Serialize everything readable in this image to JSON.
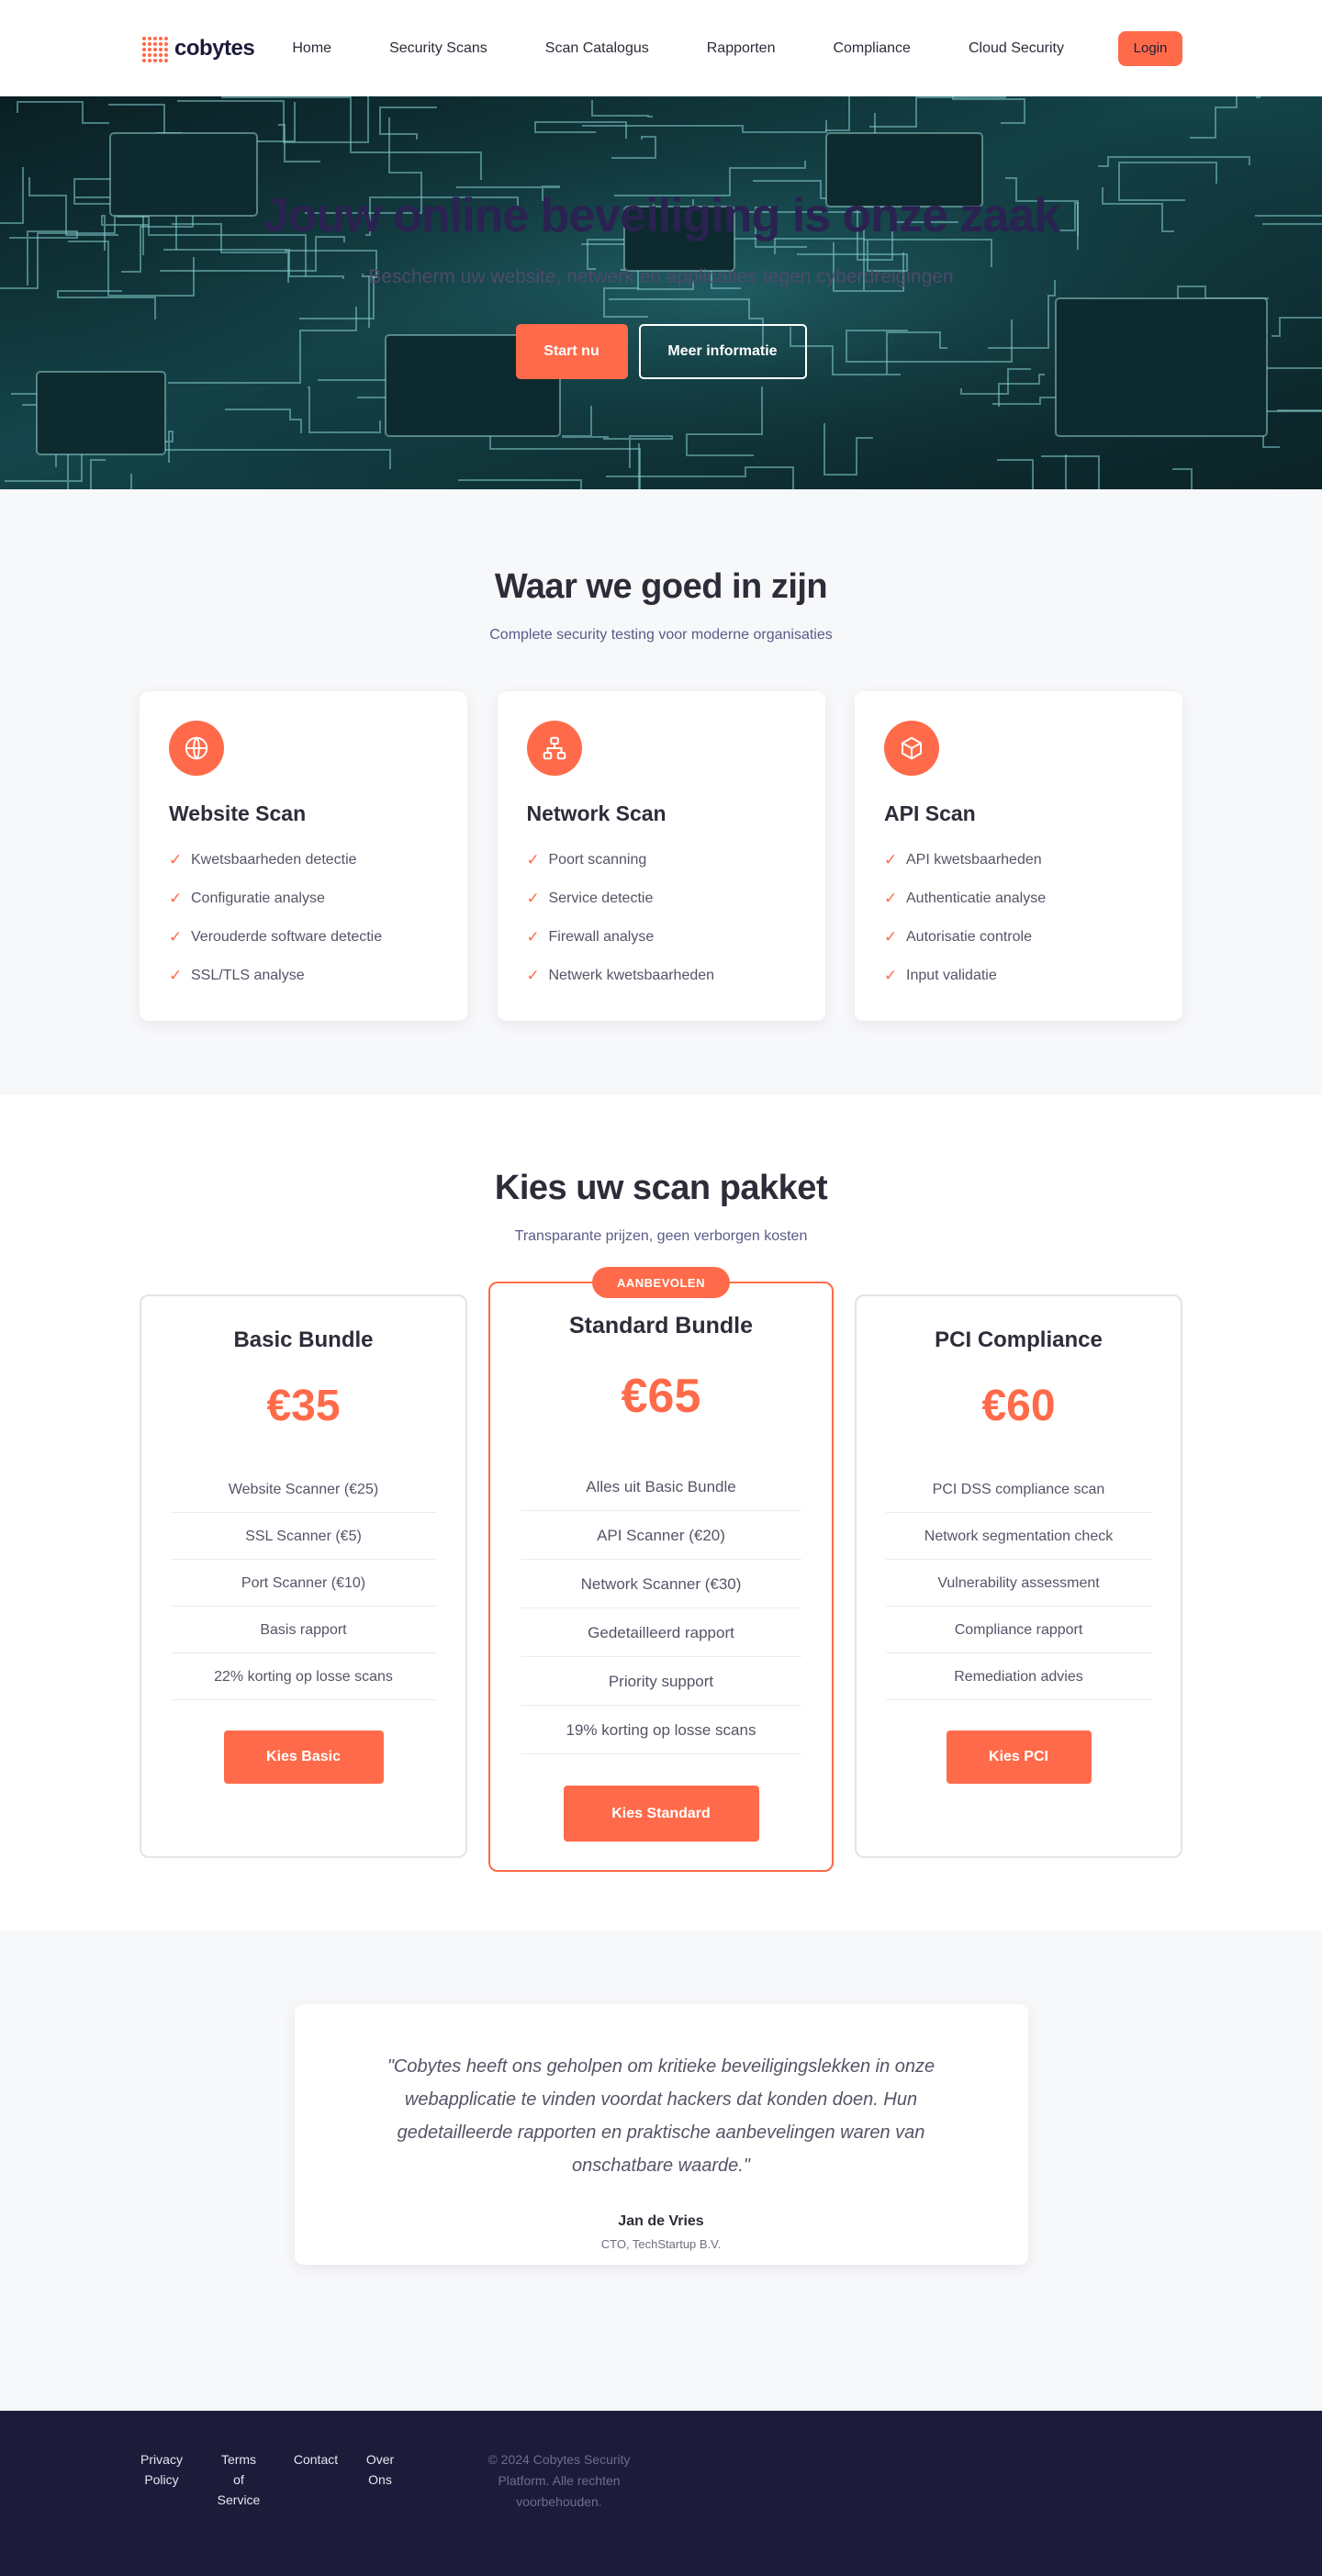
{
  "nav": {
    "logo_text": "cobytes",
    "links": [
      "Home",
      "Security Scans",
      "Scan Catalogus",
      "Rapporten",
      "Compliance",
      "Cloud Security"
    ],
    "login_label": "Login"
  },
  "hero": {
    "title": "Jouw online beveiliging is onze zaak",
    "subtitle": "Bescherm uw website, netwerk en applicaties tegen cyberdreigingen",
    "start_label": "Start nu",
    "more_label": "Meer informatie"
  },
  "services": {
    "title": "Waar we goed in zijn",
    "subtitle": "Complete security testing voor moderne organisaties",
    "cards": [
      {
        "icon": "globe-icon",
        "title": "Website Scan",
        "items": [
          "Kwetsbaarheden detectie",
          "Configuratie analyse",
          "Verouderde software detectie",
          "SSL/TLS analyse"
        ]
      },
      {
        "icon": "network-icon",
        "title": "Network Scan",
        "items": [
          "Poort scanning",
          "Service detectie",
          "Firewall analyse",
          "Netwerk kwetsbaarheden"
        ]
      },
      {
        "icon": "cube-icon",
        "title": "API Scan",
        "items": [
          "API kwetsbaarheden",
          "Authenticatie analyse",
          "Autorisatie controle",
          "Input validatie"
        ]
      }
    ]
  },
  "pricing": {
    "title": "Kies uw scan pakket",
    "subtitle": "Transparante prijzen, geen verborgen kosten",
    "plans": [
      {
        "name": "Basic Bundle",
        "price": "€35",
        "features": [
          "Website Scanner (€25)",
          "SSL Scanner (€5)",
          "Port Scanner (€10)",
          "Basis rapport",
          "22% korting op losse scans"
        ],
        "button": "Kies Basic"
      },
      {
        "name": "Standard Bundle",
        "price": "€65",
        "badge": "AANBEVOLEN",
        "features": [
          "Alles uit Basic Bundle",
          "API Scanner (€20)",
          "Network Scanner (€30)",
          "Gedetailleerd rapport",
          "Priority support",
          "19% korting op losse scans"
        ],
        "button": "Kies Standard"
      },
      {
        "name": "PCI Compliance",
        "price": "€60",
        "features": [
          "PCI DSS compliance scan",
          "Network segmentation check",
          "Vulnerability assessment",
          "Compliance rapport",
          "Remediation advies"
        ],
        "button": "Kies PCI"
      }
    ]
  },
  "testimonial": {
    "quote": "\"Cobytes heeft ons geholpen om kritieke beveiligingslekken in onze webapplicatie te vinden voordat hackers dat konden doen. Hun gedetailleerde rapporten en praktische aanbevelingen waren van onschatbare waarde.\"",
    "author": "Jan de Vries",
    "role": "CTO, TechStartup B.V."
  },
  "footer": {
    "links": [
      "Privacy Policy",
      "Terms of Service",
      "Contact",
      "Over Ons"
    ],
    "copyright": "© 2024 Cobytes Security Platform. Alle rechten voorbehouden."
  },
  "colors": {
    "accent": "#ff6b4a",
    "navy": "#1c1b3a",
    "page_bg": "#f7f8fa"
  }
}
